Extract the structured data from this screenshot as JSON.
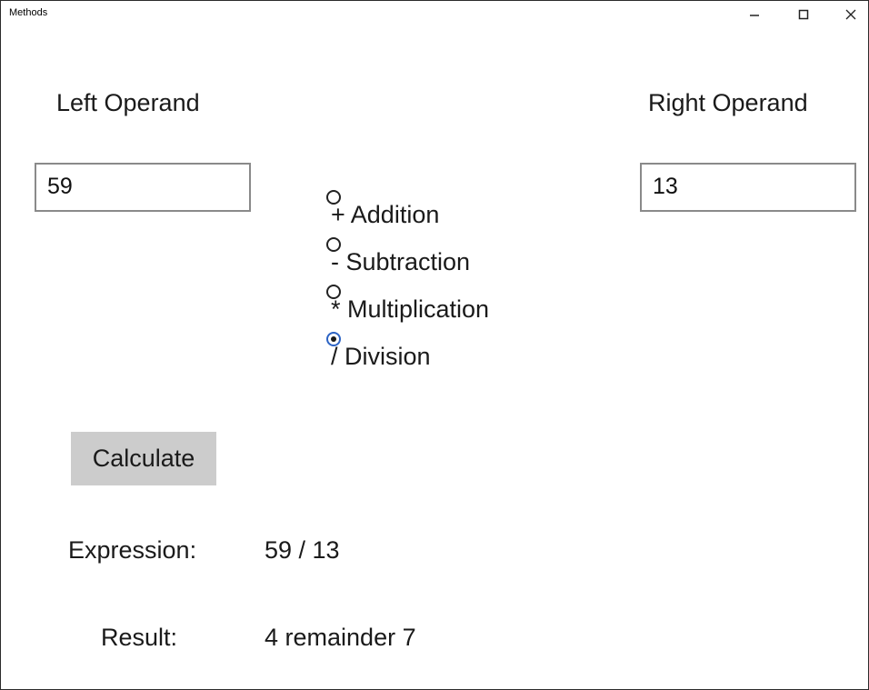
{
  "window": {
    "title": "Methods",
    "controls": {
      "minimize_icon": "minimize-icon",
      "maximize_icon": "maximize-icon",
      "close_icon": "close-icon"
    }
  },
  "operands": {
    "left_label": "Left Operand",
    "left_value": "59",
    "right_label": "Right Operand",
    "right_value": "13"
  },
  "operators": {
    "items": [
      {
        "label": "+ Addition",
        "checked": false
      },
      {
        "label": "- Subtraction",
        "checked": false
      },
      {
        "label": "* Multiplication",
        "checked": false
      },
      {
        "label": "/ Division",
        "checked": true
      }
    ]
  },
  "actions": {
    "calculate_label": "Calculate"
  },
  "output": {
    "expression_label": "Expression:",
    "expression_value": "59 / 13",
    "result_label": "Result:",
    "result_value": "4 remainder 7"
  },
  "colors": {
    "button_bg": "#cccccc",
    "input_border": "#8a8a8a",
    "radio_checked_border": "#2c63c4"
  }
}
